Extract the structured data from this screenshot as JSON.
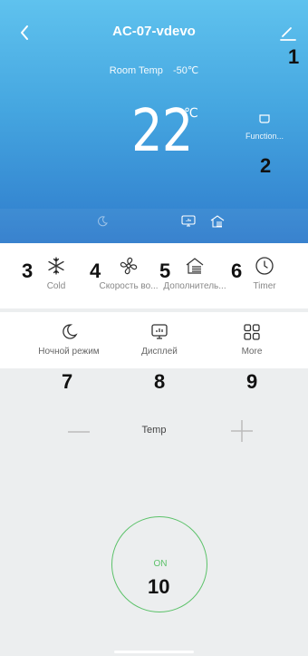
{
  "header": {
    "title": "AC-07-vdevo",
    "room_temp_label": "Room Temp",
    "room_temp_value": "-50℃",
    "set_temp": "22",
    "set_temp_unit": "℃",
    "function_label": "Function..."
  },
  "annotations": [
    "1",
    "2",
    "3",
    "4",
    "5",
    "6",
    "7",
    "8",
    "9",
    "10"
  ],
  "modes": [
    {
      "label": "Cold",
      "icon": "snowflake-icon"
    },
    {
      "label": "Скорость во...",
      "icon": "fan-icon"
    },
    {
      "label": "Дополнитель...",
      "icon": "house-heat-icon"
    },
    {
      "label": "Timer",
      "icon": "clock-icon"
    }
  ],
  "features": [
    {
      "label": "Ночной режим",
      "icon": "moon-icon"
    },
    {
      "label": "Дисплей",
      "icon": "display-icon"
    },
    {
      "label": "More",
      "icon": "grid-icon"
    }
  ],
  "temp_control": {
    "label": "Temp"
  },
  "power": {
    "label": "ON"
  },
  "colors": {
    "header_top": "#5fc2ee",
    "header_bottom": "#2f7ccc",
    "power_green": "#5cc26a",
    "body_bg": "#eceeef"
  }
}
